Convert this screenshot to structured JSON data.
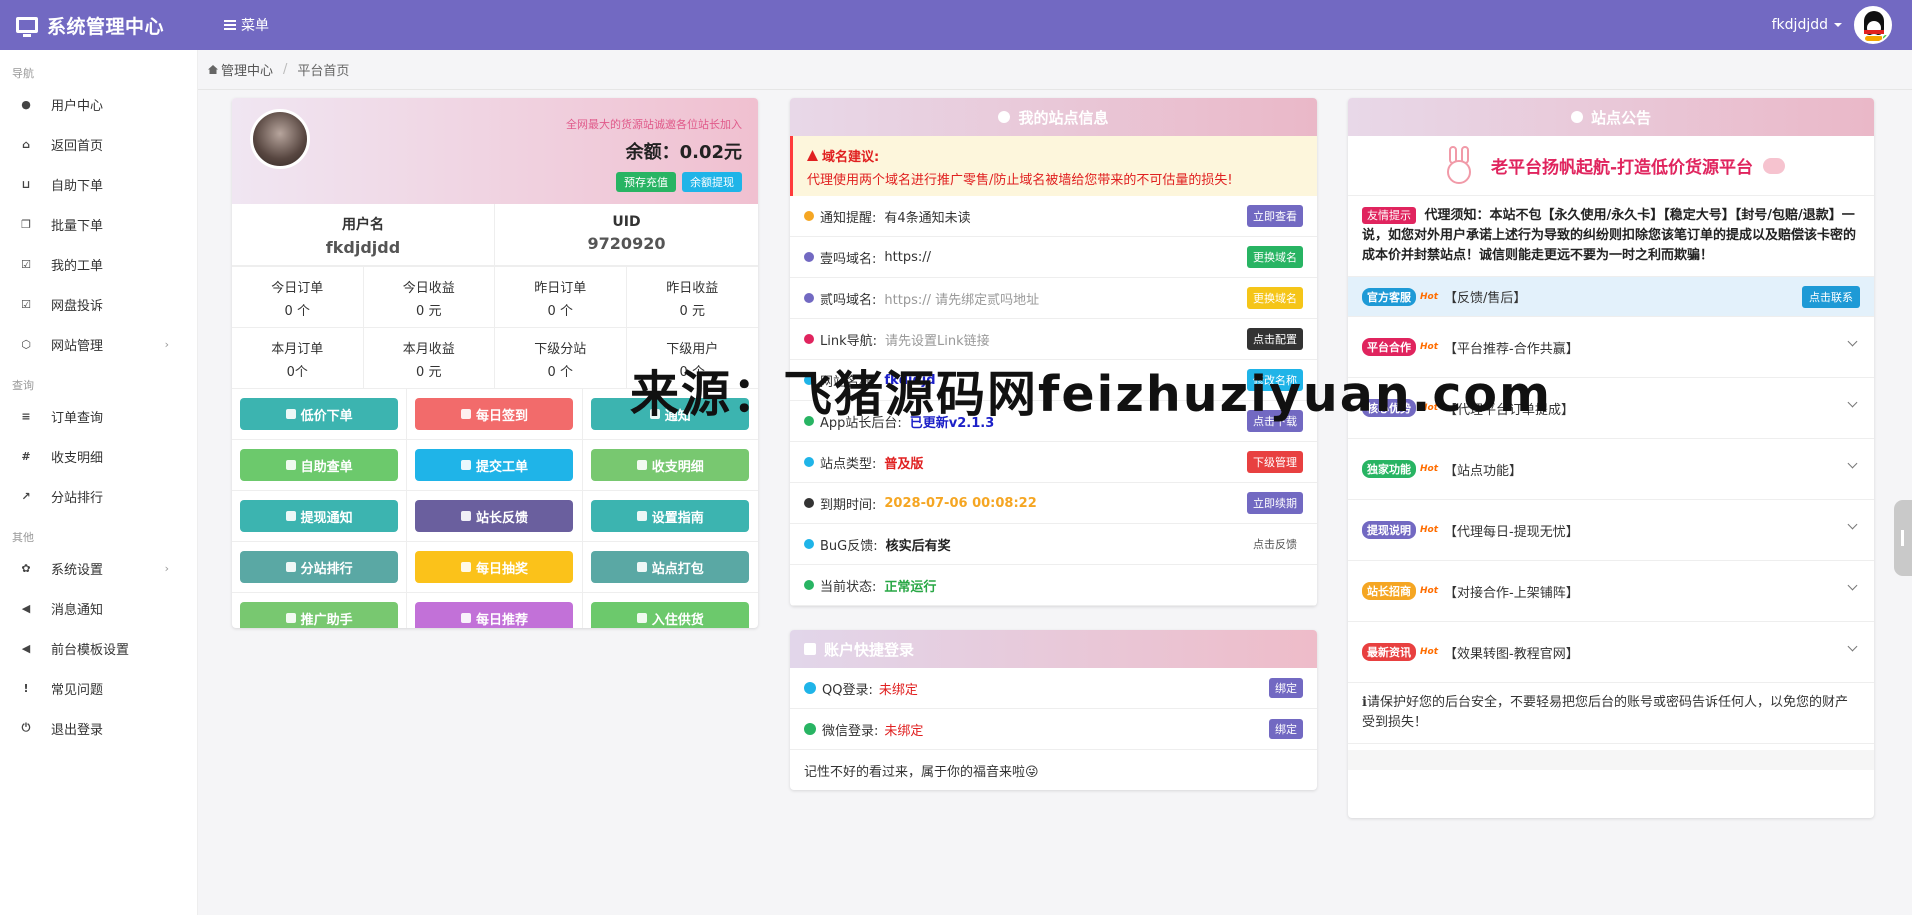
{
  "header": {
    "brand": "系统管理中心",
    "menu_label": "菜单",
    "username": "fkdjdjdd"
  },
  "sidebar": {
    "sections": [
      {
        "title": "导航",
        "items": [
          {
            "label": "用户中心",
            "icon": "user-icon"
          },
          {
            "label": "返回首页",
            "icon": "home-icon"
          },
          {
            "label": "自助下单",
            "icon": "cart-icon"
          },
          {
            "label": "批量下单",
            "icon": "copy-icon"
          },
          {
            "label": "我的工单",
            "icon": "check-square-icon"
          },
          {
            "label": "网盘投诉",
            "icon": "check-square-icon"
          },
          {
            "label": "网站管理",
            "icon": "cube-icon",
            "has_arrow": true
          }
        ]
      },
      {
        "title": "查询",
        "items": [
          {
            "label": "订单查询",
            "icon": "list-icon"
          },
          {
            "label": "收支明细",
            "icon": "hash-icon"
          },
          {
            "label": "分站排行",
            "icon": "chart-line-icon"
          }
        ]
      },
      {
        "title": "其他",
        "items": [
          {
            "label": "系统设置",
            "icon": "settings-icon",
            "has_arrow": true
          },
          {
            "label": "消息通知",
            "icon": "bullhorn-icon"
          },
          {
            "label": "前台模板设置",
            "icon": "bullhorn-icon"
          },
          {
            "label": "常见问题",
            "icon": "info-icon"
          },
          {
            "label": "退出登录",
            "icon": "power-icon"
          }
        ]
      }
    ]
  },
  "breadcrumb": {
    "home": "管理中心",
    "current": "平台首页"
  },
  "user_card": {
    "slogan": "全网最大的货源站诚邀各位站长加入",
    "balance": "余额：0.02元",
    "recharge_label": "预存充值",
    "withdraw_label": "余额提现",
    "username_label": "用户名",
    "username_value": "fkdjdjdd",
    "uid_label": "UID",
    "uid_value": "9720920",
    "stats": [
      {
        "label": "今日订单",
        "value": "0 个"
      },
      {
        "label": "今日收益",
        "value": "0 元"
      },
      {
        "label": "昨日订单",
        "value": "0 个"
      },
      {
        "label": "昨日收益",
        "value": "0 元"
      },
      {
        "label": "本月订单",
        "value": "0个"
      },
      {
        "label": "本月收益",
        "value": "0 元"
      },
      {
        "label": "下级分站",
        "value": "0 个"
      },
      {
        "label": "下级用户",
        "value": "0 个"
      }
    ],
    "actions": [
      {
        "label": "低价下单",
        "color": "#3cb4b0"
      },
      {
        "label": "每日签到",
        "color": "#f26b6b"
      },
      {
        "label": "通知",
        "color": "#3cb4b0"
      },
      {
        "label": "自助查单",
        "color": "#6cc96c"
      },
      {
        "label": "提交工单",
        "color": "#1fb4e8"
      },
      {
        "label": "收支明细",
        "color": "#78c870"
      },
      {
        "label": "提现通知",
        "color": "#3cb4b0"
      },
      {
        "label": "站长反馈",
        "color": "#6a5f9e"
      },
      {
        "label": "设置指南",
        "color": "#3cb4b0"
      },
      {
        "label": "分站排行",
        "color": "#5aa8a4"
      },
      {
        "label": "每日抽奖",
        "color": "#fbc21a"
      },
      {
        "label": "站点打包",
        "color": "#5aa8a4"
      },
      {
        "label": "推广助手",
        "color": "#78c870"
      },
      {
        "label": "每日推荐",
        "color": "#c271d8"
      },
      {
        "label": "入住供货",
        "color": "#6cc96c"
      }
    ]
  },
  "station_info": {
    "title": "我的站点信息",
    "warning_title": "域名建议:",
    "warning_text": "代理使用两个域名进行推广零售/防止域名被墙给您带来的不可估量的损失!",
    "rows": [
      {
        "label": "通知提醒:",
        "value": "有4条通知未读",
        "tag": "立即查看",
        "tag_color": "#7269c2",
        "icon_color": "#f5a623"
      },
      {
        "label": "壹吗域名:",
        "value": "https://",
        "tag": "更换域名",
        "tag_color": "#28b463",
        "icon_color": "#7269c2"
      },
      {
        "label": "贰吗域名:",
        "value": "https:// 请先绑定贰吗地址",
        "tag": "更换域名",
        "tag_color": "#f5c518",
        "icon_color": "#7269c2"
      },
      {
        "label": "Link导航:",
        "value": "请先设置Link链接",
        "tag": "点击配置",
        "tag_color": "#333333",
        "icon_color": "#e0245e"
      },
      {
        "label": "网站名称:",
        "value": "fkdjdjd",
        "tag": "修改名称",
        "tag_color": "#1fb4e8",
        "icon_color": "#1fb4e8"
      },
      {
        "label": "App站长后台:",
        "value": "已更新v2.1.3",
        "tag": "点击下载",
        "tag_color": "#7269c2",
        "icon_color": "#28b463"
      },
      {
        "label": "站点类型:",
        "value": "普及版",
        "tag": "下级管理",
        "tag_color": "#e84040",
        "icon_color": "#1fb4e8"
      },
      {
        "label": "到期时间:",
        "value": "2028-07-06 00:08:22",
        "tag": "立即续期",
        "tag_color": "#7269c2",
        "icon_color": "#333333"
      },
      {
        "label": "BuG反馈:",
        "value": "核实后有奖",
        "tag": "点击反馈",
        "tag_color": "",
        "icon_color": "#1fb4e8"
      },
      {
        "label": "当前状态:",
        "value": "正常运行",
        "tag": "",
        "tag_color": "",
        "icon_color": "#28b463"
      }
    ]
  },
  "quick_login": {
    "title": "账户快捷登录",
    "rows": [
      {
        "label": "QQ登录:",
        "status": "未绑定",
        "tag": "绑定",
        "icon_color": "#1fb4e8"
      },
      {
        "label": "微信登录:",
        "status": "未绑定",
        "tag": "绑定",
        "icon_color": "#28b463"
      }
    ],
    "footer": "记性不好的看过来，属于你的福音来啦😜"
  },
  "announce": {
    "title": "站点公告",
    "banner": "老平台扬帆起航-打造低价货源平台",
    "notice_tag": "友情提示",
    "notice_text": "代理须知：本站不包【永久使用/永久卡】【稳定大号】【封号/包赔/退款】一说，如您对外用户承诺上述行为导致的纠纷则扣除您该笔订单的提成以及赔偿该卡密的成本价并封禁站点！诚信则能走更远不要为一时之利而欺骗！",
    "items": [
      {
        "badge": "官方客服",
        "badge_color": "#1e9ad6",
        "title": "【反馈/售后】",
        "action": "点击联系"
      },
      {
        "badge": "平台合作",
        "badge_color": "#e0245e",
        "title": "【平台推荐-合作共赢】",
        "action": ""
      },
      {
        "badge": "核心优势",
        "badge_color": "#7269c2",
        "title": "【代理平台订单提成】",
        "action": ""
      },
      {
        "badge": "独家功能",
        "badge_color": "#28b463",
        "title": "【站点功能】",
        "action": ""
      },
      {
        "badge": "提现说明",
        "badge_color": "#7269c2",
        "title": "【代理每日-提现无忧】",
        "action": ""
      },
      {
        "badge": "站长招商",
        "badge_color": "#f5a623",
        "title": "【对接合作-上架铺阵】",
        "action": ""
      },
      {
        "badge": "最新资讯",
        "badge_color": "#e84040",
        "title": "【效果转图-教程官网】",
        "action": ""
      }
    ],
    "hot_label": "Hot",
    "safety": "请保护好您的后台安全，不要轻易把您后台的账号或密码告诉任何人，以免您的财产受到损失！"
  },
  "watermark": "来源：飞猪源码网feizhuziyuan.com"
}
